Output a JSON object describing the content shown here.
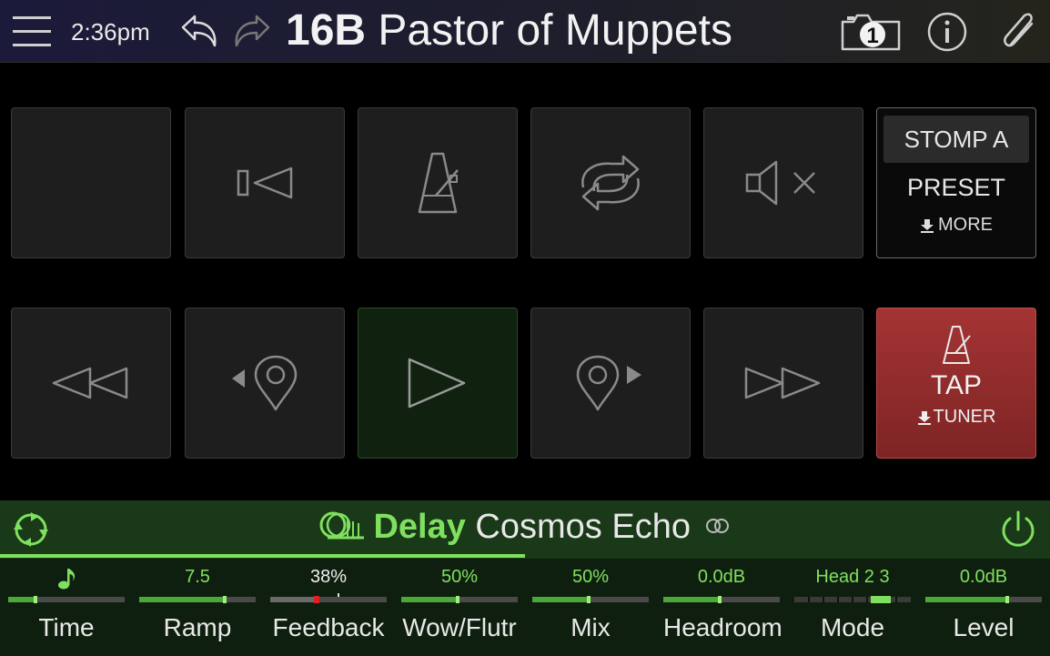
{
  "header": {
    "time": "2:36pm",
    "preset_number": "16B",
    "preset_name": "Pastor of Muppets",
    "snapshot_number": "1"
  },
  "pads": [
    {
      "id": "empty",
      "icon": "none"
    },
    {
      "id": "return-to-start",
      "icon": "return-to-start-icon"
    },
    {
      "id": "metronome",
      "icon": "metronome-icon"
    },
    {
      "id": "loop",
      "icon": "loop-icon"
    },
    {
      "id": "mute",
      "icon": "speaker-mute-icon"
    },
    {
      "id": "rewind",
      "icon": "rewind-icon"
    },
    {
      "id": "prev-marker",
      "icon": "prev-marker-icon"
    },
    {
      "id": "play",
      "icon": "play-icon"
    },
    {
      "id": "next-marker",
      "icon": "next-marker-icon"
    },
    {
      "id": "fast-forward",
      "icon": "fast-forward-icon"
    }
  ],
  "stomp": {
    "mode": "STOMP A",
    "label": "PRESET",
    "more": "MORE"
  },
  "tap": {
    "label": "TAP",
    "tuner": "TUNER"
  },
  "fx": {
    "category": "Delay",
    "model": "Cosmos Echo",
    "progress": 0.5
  },
  "params": [
    {
      "label": "Time",
      "value": "♪",
      "level": 0.25
    },
    {
      "label": "Ramp",
      "value": "7.5",
      "level": 0.75
    },
    {
      "label": "Feedback",
      "value": "38%",
      "level": 0.38
    },
    {
      "label": "Wow/Flutr",
      "value": "50%",
      "level": 0.5
    },
    {
      "label": "Mix",
      "value": "50%",
      "level": 0.5
    },
    {
      "label": "Headroom",
      "value": "0.0dB",
      "level": 0.5
    },
    {
      "label": "Mode",
      "value": "Head 2 3",
      "level": 0.75
    },
    {
      "label": "Level",
      "value": "0.0dB",
      "level": 0.72
    }
  ],
  "colors": {
    "accent_green": "#7fe05f",
    "tap_red": "#a43434",
    "fx_bar": "#193918"
  }
}
